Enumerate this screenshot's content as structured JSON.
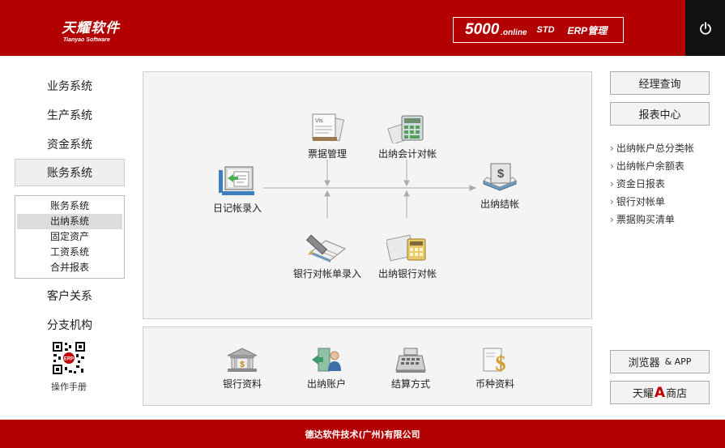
{
  "header": {
    "logo_cn": "天耀软件",
    "logo_en": "Tianyao Software",
    "product_num": "5000",
    "product_online": ".online",
    "product_std": "STD",
    "product_erp": "ERP管理"
  },
  "nav": {
    "items": [
      "业务系统",
      "生产系统",
      "资金系统",
      "账务系统",
      "客户关系",
      "分支机构"
    ],
    "subitems": [
      "账务系统",
      "出纳系统",
      "固定资产",
      "工资系统",
      "合并报表"
    ],
    "manual_label": "操作手册"
  },
  "flow": {
    "ticket": "票据管理",
    "cashier_check": "出纳会计对帐",
    "journal_entry": "日记帐录入",
    "cashier_close": "出纳结帐",
    "bank_statement_entry": "银行对帐单录入",
    "cashier_bank_check": "出纳银行对帐"
  },
  "basic": {
    "bank_info": "银行资料",
    "cashier_account": "出纳账户",
    "settlement": "结算方式",
    "currency": "币种资料"
  },
  "right": {
    "manager_query": "经理查询",
    "report_center": "报表中心",
    "reports": [
      "出纳帐户总分类帐",
      "出纳帐户余额表",
      "资金日报表",
      "银行对帐单",
      "票据购买清单"
    ],
    "browser_label": "浏览器",
    "browser_suffix": "& APP",
    "store_pre": "天耀",
    "store_a": "A",
    "store_post": "商店"
  },
  "footer": {
    "company": "德达软件技术(广州)有限公司"
  },
  "colors": {
    "brand_red": "#b30000",
    "power_bg": "#111111",
    "panel_bg": "#f4f4f4"
  }
}
